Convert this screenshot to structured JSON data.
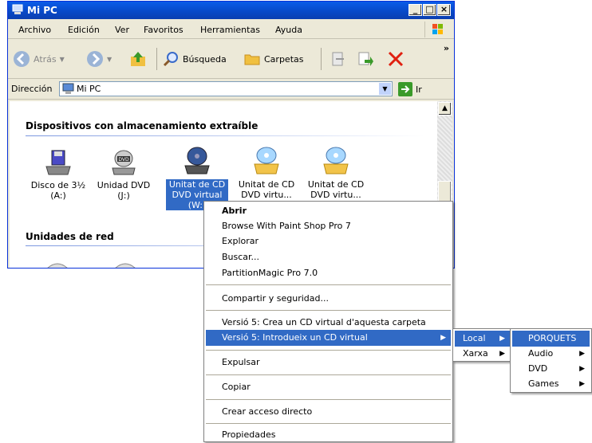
{
  "window": {
    "title": "Mi PC",
    "min": "_",
    "max": "□",
    "close": "×"
  },
  "menubar": [
    "Archivo",
    "Edición",
    "Ver",
    "Favoritos",
    "Herramientas",
    "Ayuda"
  ],
  "toolbar": {
    "back": "Atrás",
    "search": "Búsqueda",
    "folders": "Carpetas"
  },
  "address": {
    "label": "Dirección",
    "value": "Mi PC",
    "go": "Ir"
  },
  "content": {
    "section1": "Dispositivos con almacenamiento extraíble",
    "section2": "Unidades de red",
    "devices": [
      {
        "line1": "Disco de 3½",
        "line2": "(A:)",
        "icon": "floppy-drive-icon"
      },
      {
        "line1": "Unidad DVD",
        "line2": "(J:)",
        "icon": "dvd-drive-icon"
      },
      {
        "line1": "Unitat de CD",
        "line2": "DVD virtual",
        "line3": "(W:)",
        "icon": "virtual-cd-drive-icon"
      },
      {
        "line1": "Unitat de CD",
        "line2": "DVD virtu...",
        "icon": "virtual-cd-drive-icon"
      },
      {
        "line1": "Unitat de CD",
        "line2": "DVD virtu...",
        "icon": "virtual-cd-drive-icon"
      }
    ]
  },
  "context_menu": {
    "abrir": "Abrir",
    "paintshop": "Browse With Paint Shop Pro 7",
    "explorar": "Explorar",
    "buscar": "Buscar...",
    "partition": "PartitionMagic Pro 7.0",
    "compartir": "Compartir y seguridad...",
    "version5_crea": "Versió 5: Crea un CD virtual d'aquesta carpeta",
    "version5_intro": "Versió 5: Introdueix un CD virtual",
    "expulsar": "Expulsar",
    "copiar": "Copiar",
    "crear": "Crear acceso directo",
    "propiedades": "Propiedades"
  },
  "submenu1": {
    "local": "Local",
    "xarxa": "Xarxa"
  },
  "submenu2": {
    "porquets": "PORQUETS",
    "audio": "Audio",
    "dvd": "DVD",
    "games": "Games"
  },
  "colors": {
    "titlebar": "#0a5ce8",
    "highlight": "#316ac5"
  }
}
